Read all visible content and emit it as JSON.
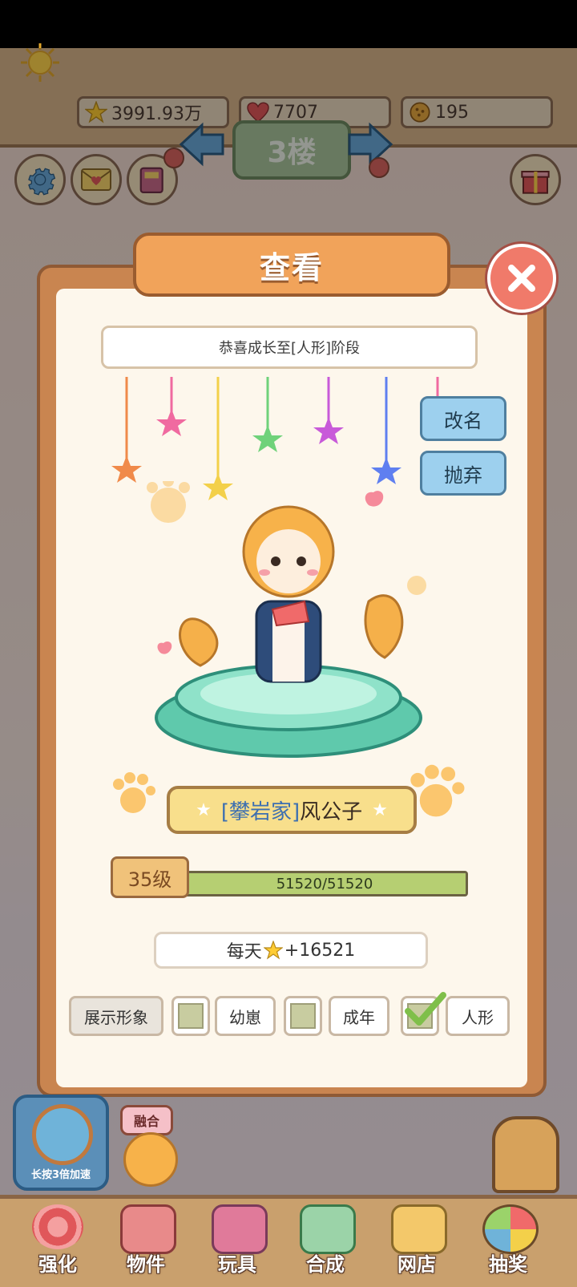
{
  "resources": {
    "coins": "3991.93万",
    "hearts": "7707",
    "cookies": "195"
  },
  "floor": {
    "label": "3楼"
  },
  "dialog": {
    "title": "查看",
    "message": "恭喜成长至[人形]阶段",
    "rename_button": "改名",
    "discard_button": "抛弃",
    "name_tag": "[攀岩家]",
    "name": "风公子",
    "level": "35级",
    "exp_text": "51520/51520",
    "exp_fraction": 1.0,
    "daily_prefix": "每天",
    "daily_value": "+16521",
    "display_label": "展示形象",
    "options": [
      {
        "label": "幼崽",
        "checked": false
      },
      {
        "label": "成年",
        "checked": false
      },
      {
        "label": "人形",
        "checked": true
      }
    ]
  },
  "left_dock": {
    "label": "长按3倍加速"
  },
  "fusion_badge": "融合",
  "nav": [
    {
      "label": "强化"
    },
    {
      "label": "物件"
    },
    {
      "label": "玩具"
    },
    {
      "label": "合成"
    },
    {
      "label": "网店"
    },
    {
      "label": "抽奖"
    }
  ]
}
